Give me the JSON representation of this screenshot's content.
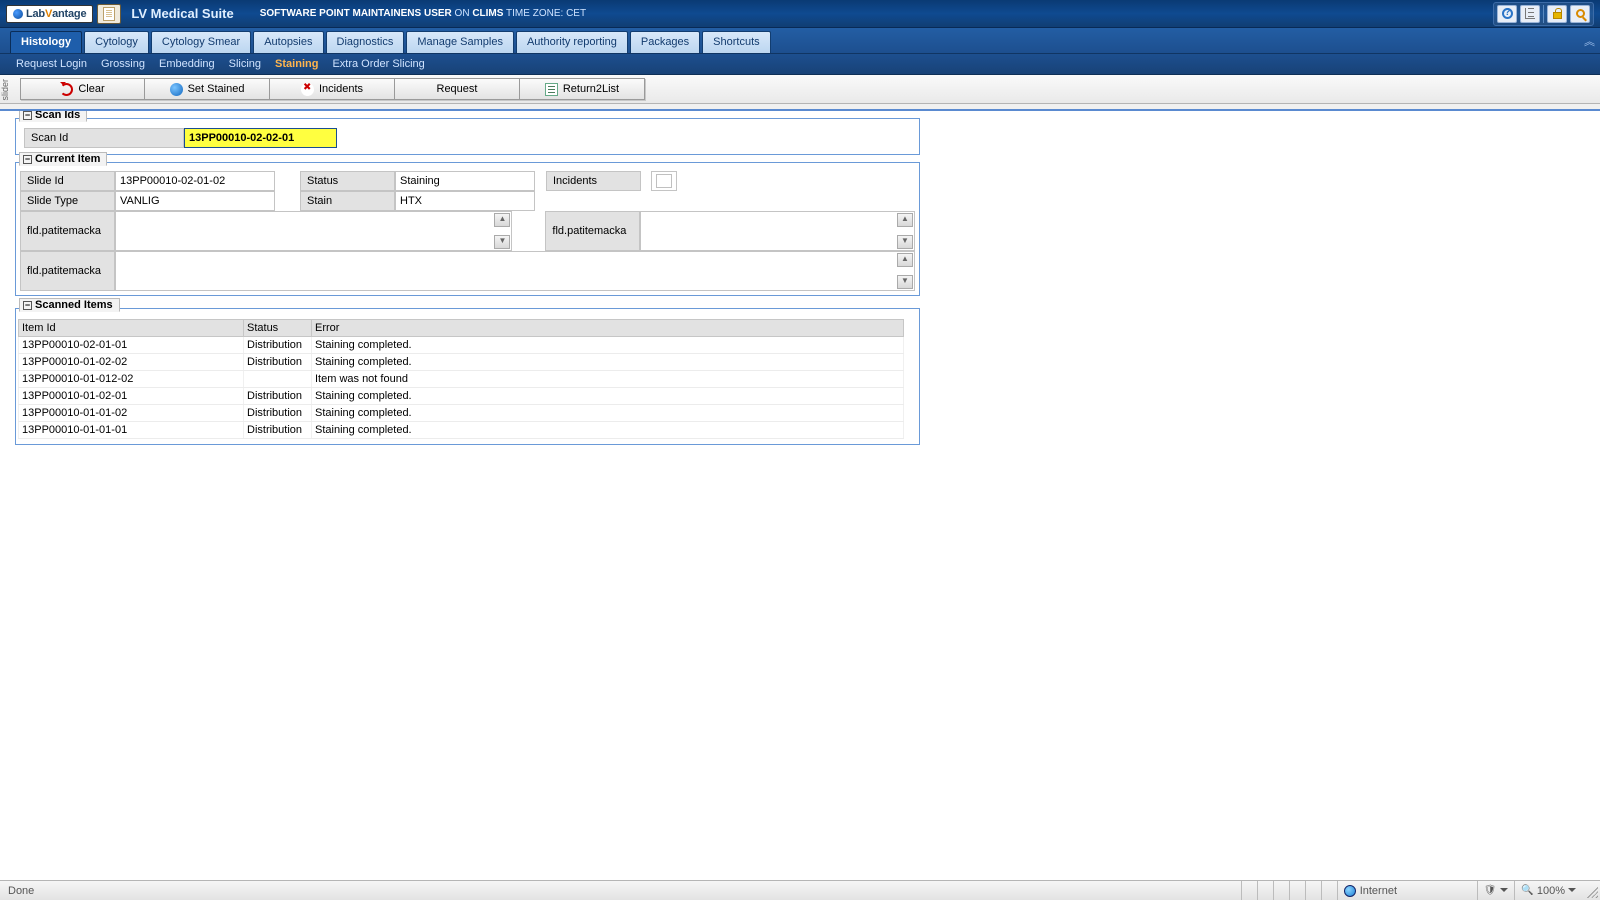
{
  "header": {
    "logo_text": "LabVantage",
    "app_title": "LV Medical Suite",
    "user_prefix": "SOFTWARE POINT MAINTAINENS USER",
    "on": "ON",
    "system": "CLIMS",
    "tz_label": "TIME ZONE:",
    "tz_value": "CET"
  },
  "maintabs": [
    "Histology",
    "Cytology",
    "Cytology Smear",
    "Autopsies",
    "Diagnostics",
    "Manage Samples",
    "Authority reporting",
    "Packages",
    "Shortcuts"
  ],
  "maintabs_active": 0,
  "subtabs": [
    "Request Login",
    "Grossing",
    "Embedding",
    "Slicing",
    "Staining",
    "Extra Order Slicing"
  ],
  "subtabs_active": 4,
  "buttons": {
    "clear": "Clear",
    "set_stained": "Set Stained",
    "incidents": "Incidents",
    "request": "Request",
    "return2list": "Return2List"
  },
  "slider_label": "slider",
  "panels": {
    "scan_ids": {
      "title": "Scan Ids",
      "scan_id_label": "Scan Id",
      "scan_id_value": "13PP00010-02-02-01"
    },
    "current_item": {
      "title": "Current Item",
      "slide_id_label": "Slide Id",
      "slide_id_value": "13PP00010-02-01-02",
      "slide_type_label": "Slide Type",
      "slide_type_value": "VANLIG",
      "status_label": "Status",
      "status_value": "Staining",
      "stain_label": "Stain",
      "stain_value": "HTX",
      "incidents_label": "Incidents",
      "incidents_value": "",
      "macka_a": "fld.patitemacka",
      "macka_b": "fld.patitemacka",
      "macka_c": "fld.patitemacka"
    },
    "scanned_items": {
      "title": "Scanned Items",
      "cols": {
        "item_id": "Item Id",
        "status": "Status",
        "error": "Error"
      },
      "rows": [
        {
          "id": "13PP00010-02-01-01",
          "status": "Distribution",
          "error": "Staining completed."
        },
        {
          "id": "13PP00010-01-02-02",
          "status": "Distribution",
          "error": "Staining completed."
        },
        {
          "id": "13PP00010-01-012-02",
          "status": "",
          "error": "Item was not found"
        },
        {
          "id": "13PP00010-01-02-01",
          "status": "Distribution",
          "error": "Staining completed."
        },
        {
          "id": "13PP00010-01-01-02",
          "status": "Distribution",
          "error": "Staining completed."
        },
        {
          "id": "13PP00010-01-01-01",
          "status": "Distribution",
          "error": "Staining completed."
        }
      ]
    }
  },
  "statusbar": {
    "done": "Done",
    "zone": "Internet",
    "zoom": "100%"
  }
}
